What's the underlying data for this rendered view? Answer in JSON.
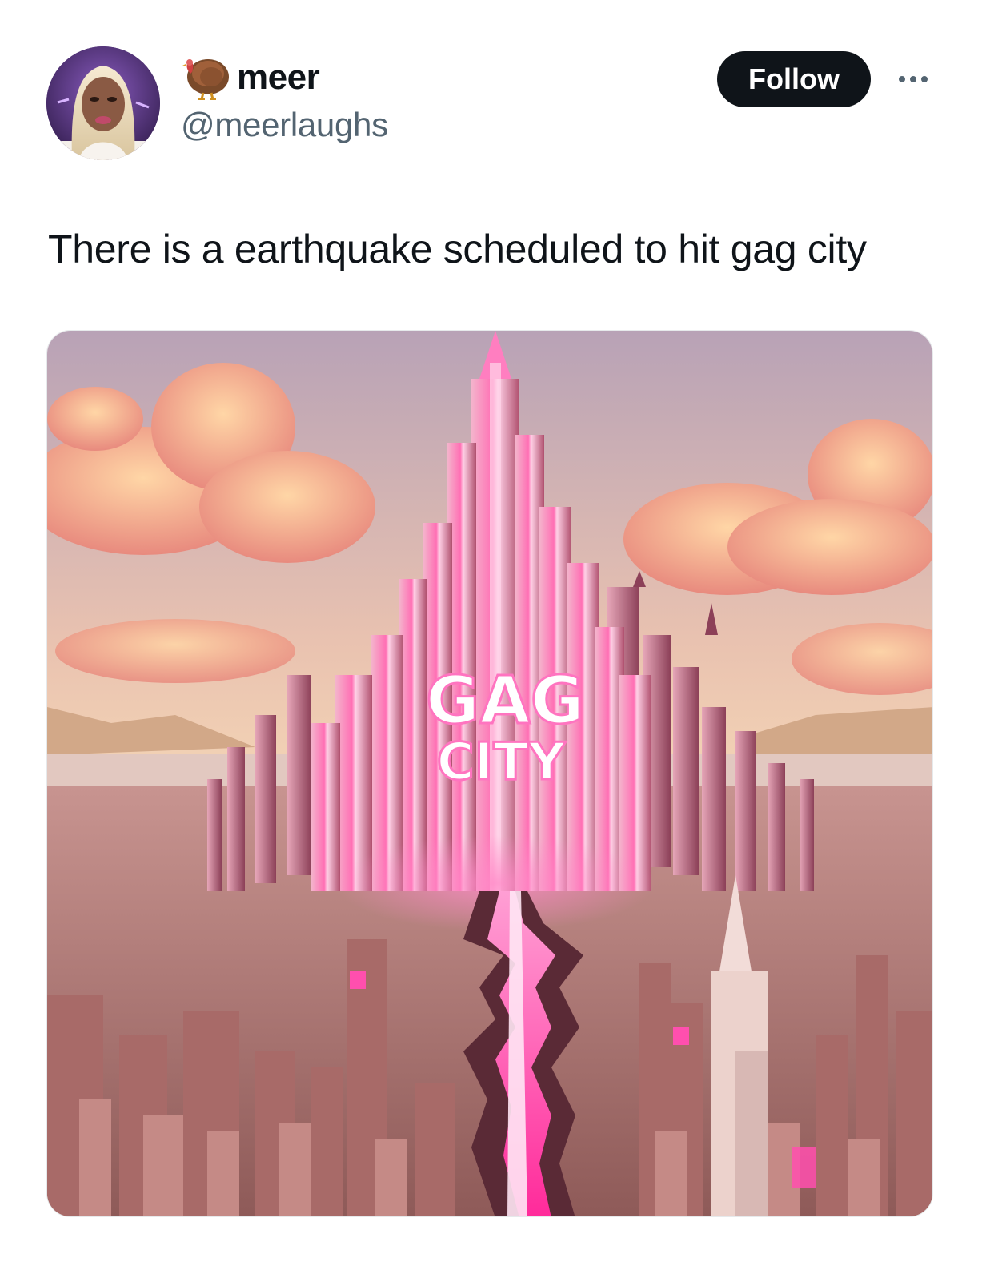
{
  "tweet": {
    "display_name": "meer",
    "handle": "@meerlaughs",
    "follow_label": "Follow",
    "text": "There is a earthquake scheduled to hit gag city"
  },
  "media": {
    "sign_line1": "GAG",
    "sign_line2": "CITY"
  },
  "icons": {
    "name_emoji": "turkey-icon",
    "more": "more-options-icon"
  },
  "colors": {
    "follow_bg": "#0f1419",
    "handle": "#536471",
    "accent_pink": "#ff3fa4"
  }
}
